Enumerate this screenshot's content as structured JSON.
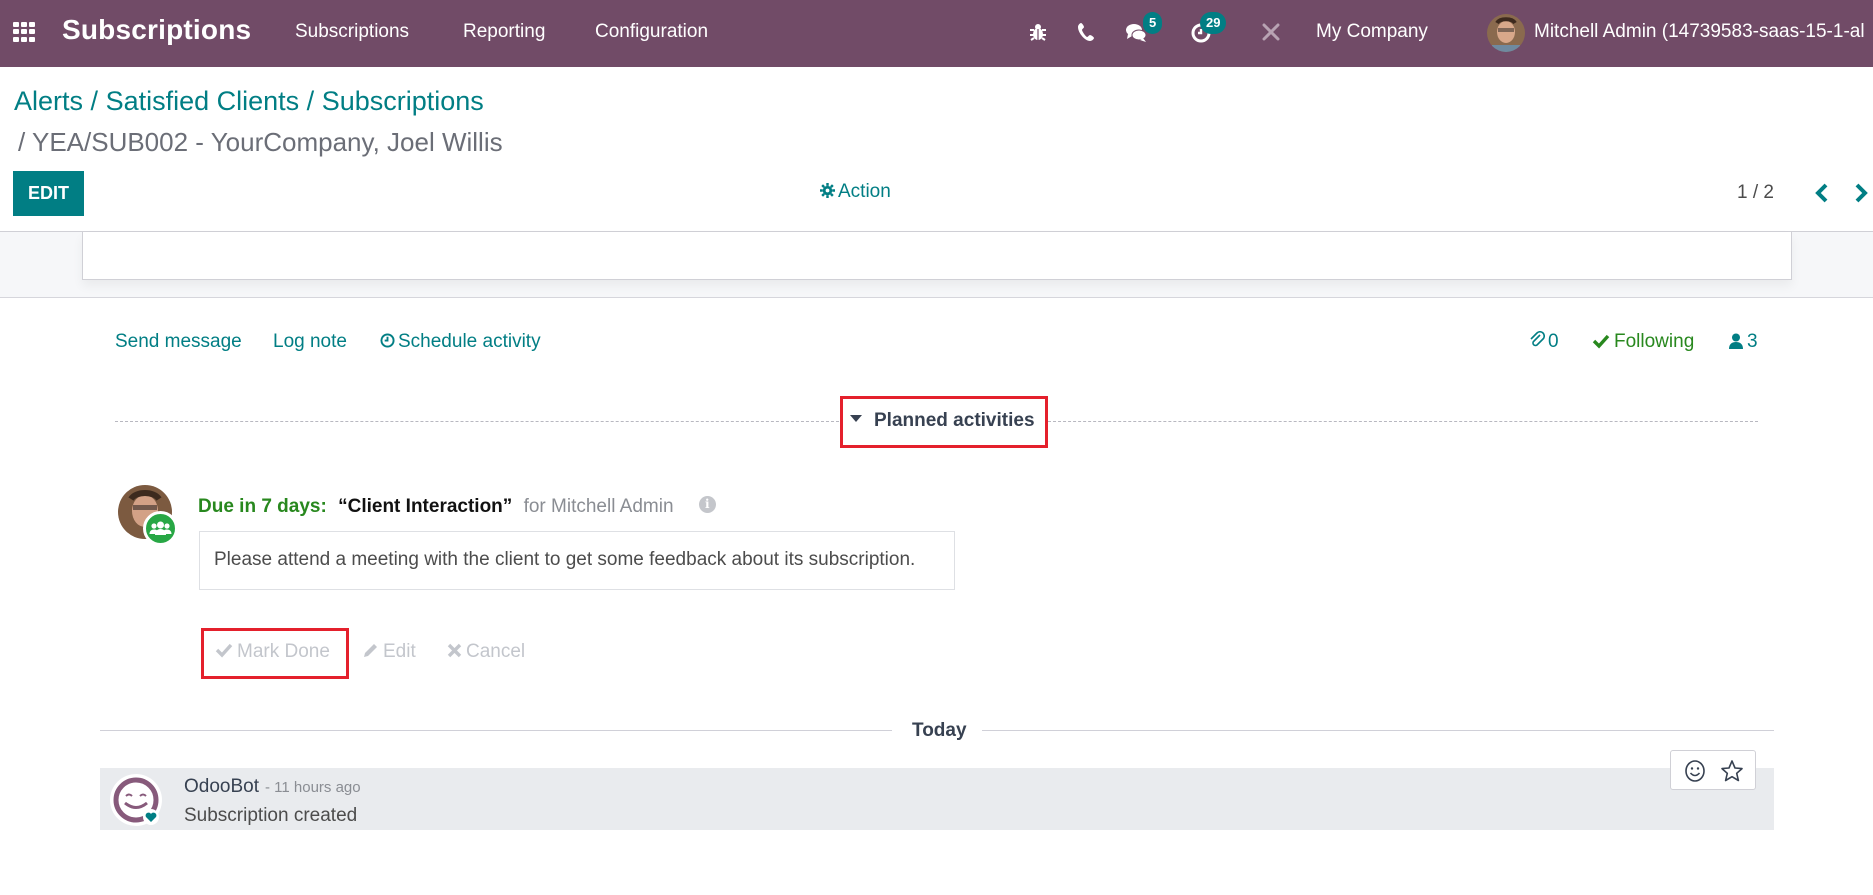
{
  "navbar": {
    "app_title": "Subscriptions",
    "menu": [
      "Subscriptions",
      "Reporting",
      "Configuration"
    ],
    "icons": [
      "bug-icon",
      "phone-icon",
      "chat-icon",
      "activity-clock-icon",
      "tools-icon"
    ],
    "messages_badge": "5",
    "activities_badge": "29",
    "company": "My Company",
    "user": "Mitchell Admin (14739583-saas-15-1-al"
  },
  "control_panel": {
    "breadcrumb": [
      "Alerts",
      "Satisfied Clients",
      "Subscriptions"
    ],
    "breadcrumb_separator": "/",
    "record_title": "/ YEA/SUB002 - YourCompany, Joel Willis",
    "edit_label": "EDIT",
    "action_label": "Action",
    "pager": "1 / 2"
  },
  "chatter": {
    "send_message": "Send message",
    "log_note": "Log note",
    "schedule_activity": "Schedule activity",
    "attachments_count": "0",
    "following_label": "Following",
    "followers_count": "3"
  },
  "planned_activities": {
    "title": "Planned activities",
    "activity": {
      "due": "Due in 7 days:",
      "name": "“Client Interaction”",
      "assignee": "for Mitchell Admin",
      "description": "Please attend a meeting with the client to get some feedback about its subscription.",
      "actions": {
        "mark_done": "Mark Done",
        "edit": "Edit",
        "cancel": "Cancel"
      }
    }
  },
  "messages": {
    "date_separator": "Today",
    "items": [
      {
        "author": "OdooBot",
        "date": "- 11 hours ago",
        "body": "Subscription created"
      }
    ]
  },
  "colors": {
    "navbar": "#714B67",
    "accent": "#017E84",
    "success": "#28881e",
    "highlight": "#e4202c"
  }
}
